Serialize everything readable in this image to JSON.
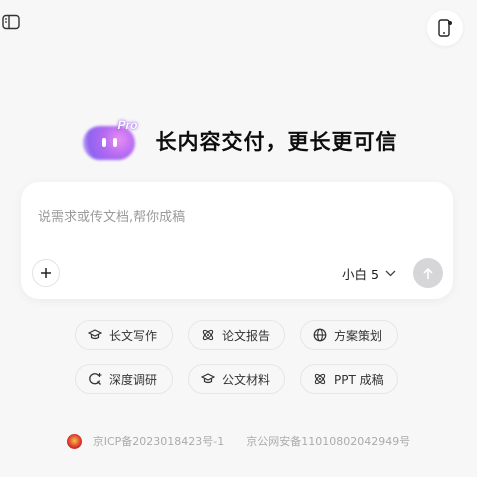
{
  "hero": {
    "badge": "Pro",
    "title": "长内容交付，更长更可信"
  },
  "composer": {
    "placeholder": "说需求或传文档,帮你成稿",
    "model_label": "小白 5",
    "icons": {
      "add": "plus-icon",
      "model": "chevron-down-icon",
      "send": "arrow-up-icon"
    }
  },
  "chips": [
    {
      "label": "长文写作",
      "icon": "graduation-cap-icon"
    },
    {
      "label": "论文报告",
      "icon": "atom-icon"
    },
    {
      "label": "方案策划",
      "icon": "globe-icon"
    },
    {
      "label": "深度调研",
      "icon": "deep-search-icon"
    },
    {
      "label": "公文材料",
      "icon": "graduation-cap-icon"
    },
    {
      "label": "PPT 成稿",
      "icon": "atom-icon"
    }
  ],
  "footer": {
    "icp": "京ICP备2023018423号-1",
    "police": "京公网安备11010802042949号"
  },
  "colors": {
    "background": "#f7f7f8",
    "send_disabled": "#d6d6d8",
    "mascot_purple": "#a76cf2"
  },
  "header": {
    "icons": {
      "sidebar": "sidebar-toggle-icon",
      "mobile": "mobile-device-icon"
    }
  }
}
